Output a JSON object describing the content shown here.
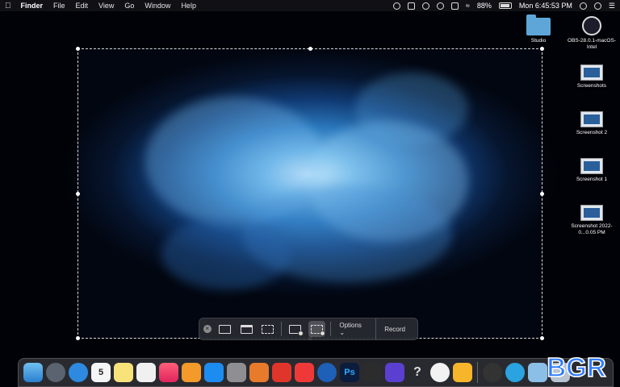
{
  "menubar": {
    "app_name": "Finder",
    "items": [
      "File",
      "Edit",
      "View",
      "Go",
      "Window",
      "Help"
    ],
    "battery": "88%",
    "clock": "Mon 6:45:53 PM"
  },
  "desktop_icons": [
    {
      "label": "Studio",
      "icon": "folder-icon"
    },
    {
      "label": "OBS-28.0.1-macOS-Intel",
      "icon": "obs-icon"
    },
    {
      "label": "Screenshots",
      "icon": "screenshots-folder-icon"
    },
    {
      "label": "Screenshot 2",
      "icon": "screenshot-icon"
    },
    {
      "label": "Screenshot 1",
      "icon": "screenshot-icon"
    },
    {
      "label": "Screenshot 2022-0...0.05 PM",
      "icon": "screenshot-icon"
    }
  ],
  "toolbar": {
    "options_label": "Options",
    "record_label": "Record"
  },
  "dock": {
    "apps": [
      "Finder",
      "Launchpad",
      "Safari",
      "Calendar",
      "Notes",
      "Reminders",
      "Music",
      "Books",
      "App Store",
      "System Preferences",
      "Spark",
      "Slides",
      "Vivaldi",
      "Prime Video",
      "Photoshop",
      "Figma",
      "Proton VPN",
      "Help",
      "Chrome",
      "Sketch",
      "OBS",
      "Telegram",
      "Preview",
      "Trash"
    ],
    "calendar_day": "5",
    "photoshop_label": "Ps"
  },
  "watermark": "BGR"
}
